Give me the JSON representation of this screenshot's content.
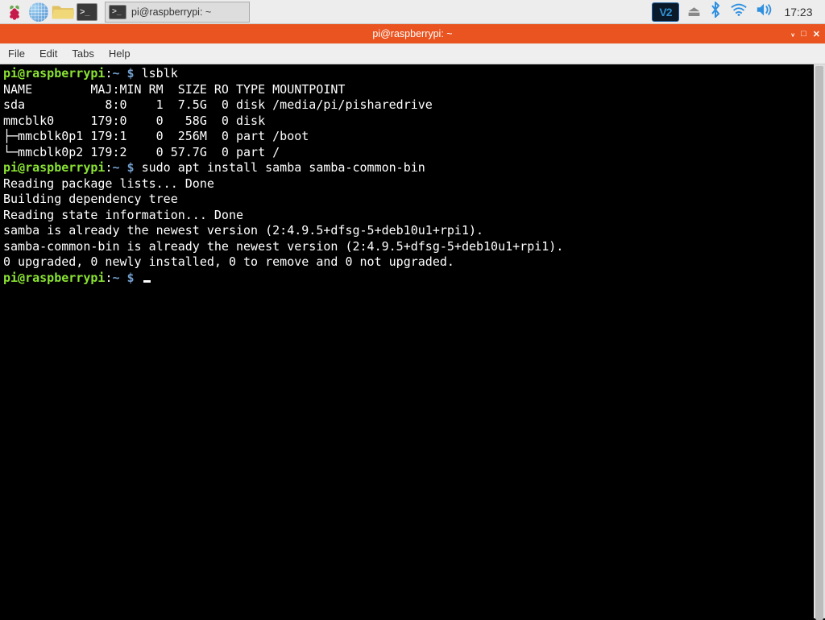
{
  "taskbar": {
    "task_label": "pi@raspberrypi: ~",
    "vnc_label": "V2",
    "clock": "17:23"
  },
  "window": {
    "title": "pi@raspberrypi: ~"
  },
  "menu": {
    "file": "File",
    "edit": "Edit",
    "tabs": "Tabs",
    "help": "Help"
  },
  "prompt": {
    "user_host": "pi@raspberrypi",
    "colon": ":",
    "path": "~ $",
    "dollar_only": "$"
  },
  "term": {
    "cmd1": " lsblk",
    "hdr": "NAME        MAJ:MIN RM  SIZE RO TYPE MOUNTPOINT",
    "r1": "sda           8:0    1  7.5G  0 disk /media/pi/pisharedrive",
    "r2": "mmcblk0     179:0    0   58G  0 disk ",
    "r3": "├─mmcblk0p1 179:1    0  256M  0 part /boot",
    "r4": "└─mmcblk0p2 179:2    0 57.7G  0 part /",
    "cmd2": " sudo apt install samba samba-common-bin",
    "o1": "Reading package lists... Done",
    "o2": "Building dependency tree       ",
    "o3": "Reading state information... Done",
    "o4": "samba is already the newest version (2:4.9.5+dfsg-5+deb10u1+rpi1).",
    "o5": "samba-common-bin is already the newest version (2:4.9.5+dfsg-5+deb10u1+rpi1).",
    "o6": "0 upgraded, 0 newly installed, 0 to remove and 0 not upgraded."
  }
}
